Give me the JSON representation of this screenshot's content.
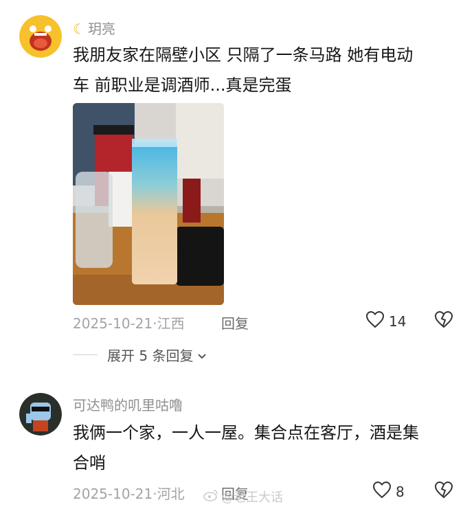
{
  "comments": [
    {
      "username": "玥亮",
      "text_lines": [
        "我朋友家在隔壁小区 只隔了一条马路 她有电动",
        "车  前职业是调酒师...真是完蛋"
      ],
      "date": "2025-10-21",
      "location": "江西",
      "reply_label": "回复",
      "likes": "14",
      "expand_label": "展开 5 条回复"
    },
    {
      "username": "可达鸭的叽里咕噜",
      "text_lines": [
        "我俩一个家，一人一屋。集合点在客厅，酒是集",
        "合哨"
      ],
      "date": "2025-10-21",
      "location": "河北",
      "reply_label": "回复",
      "likes": "8"
    }
  ],
  "separator": "·",
  "watermark": "@老王大话",
  "icons": {
    "moon": "crescent-moon-icon",
    "like": "heart-outline-icon",
    "dislike": "broken-heart-icon",
    "expand": "chevron-down-icon"
  }
}
